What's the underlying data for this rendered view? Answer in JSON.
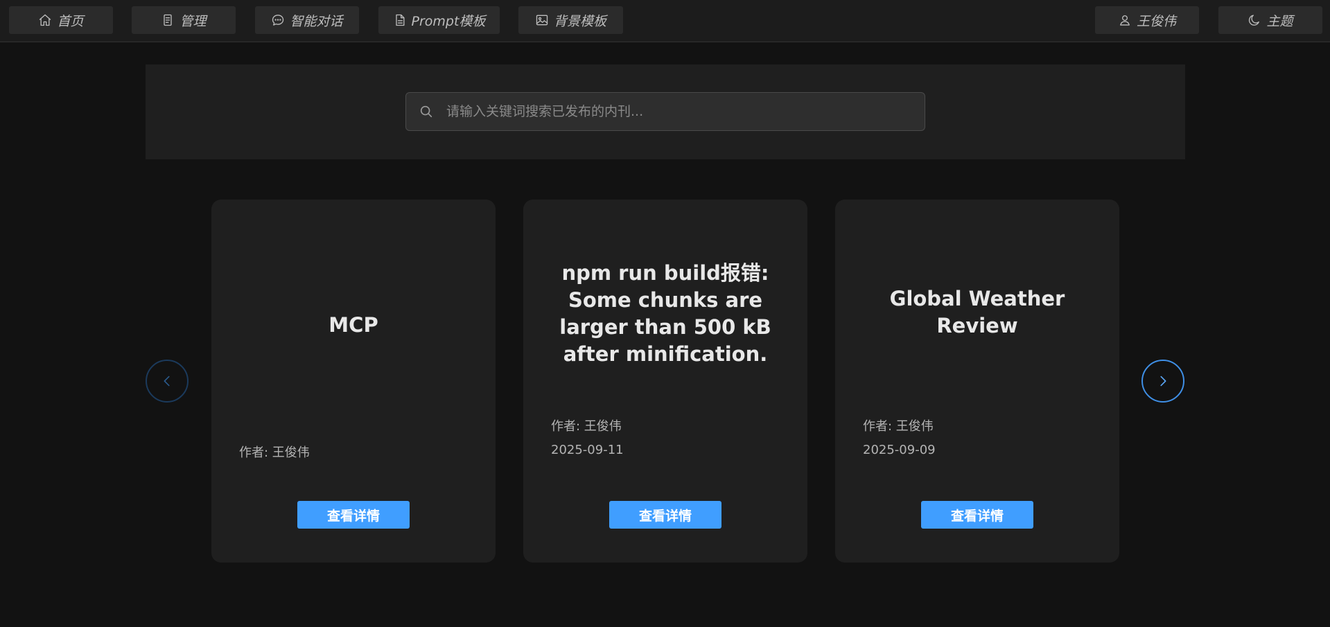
{
  "nav": {
    "left": [
      {
        "label": "首页",
        "icon": "home-icon"
      },
      {
        "label": "管理",
        "icon": "document-icon"
      },
      {
        "label": "智能对话",
        "icon": "chat-bubble-icon"
      },
      {
        "label": "Prompt模板",
        "icon": "file-icon"
      },
      {
        "label": "背景模板",
        "icon": "image-icon"
      }
    ],
    "right": [
      {
        "label": "王俊伟",
        "icon": "user-icon"
      },
      {
        "label": "主题",
        "icon": "moon-icon"
      }
    ]
  },
  "search": {
    "placeholder": "请输入关键词搜索已发布的内刊..."
  },
  "carousel": {
    "cards": [
      {
        "title": "MCP",
        "author": "作者: 王俊伟",
        "date": "",
        "button": "查看详情"
      },
      {
        "title": "npm run build报错: Some chunks are larger than 500 kB after minification.",
        "author": "作者: 王俊伟",
        "date": "2025-09-11",
        "button": "查看详情"
      },
      {
        "title": "Global Weather Review",
        "author": "作者: 王俊伟",
        "date": "2025-09-09",
        "button": "查看详情"
      }
    ]
  },
  "colors": {
    "accent": "#409eff",
    "background": "#121212",
    "card": "#1f1f1f",
    "nav_button": "#2b2b2b"
  }
}
